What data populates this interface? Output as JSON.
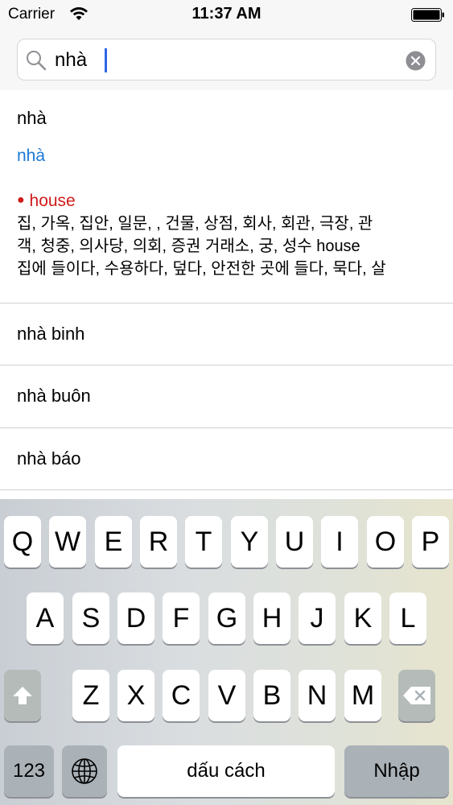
{
  "status_bar": {
    "carrier": "Carrier",
    "time": "11:37 AM"
  },
  "search": {
    "value": "nhà",
    "icons": [
      "search-icon",
      "clear-icon"
    ]
  },
  "results": {
    "expanded": {
      "title": "nhà",
      "sub_word": "nhà",
      "bullet": "●",
      "definition_word": "house",
      "meaning_lines": [
        "집, 가옥, 집안, 일문, , 건물, 상점, 회사, 회관, 극장, 관",
        "객, 청중, 의사당, 의회, 증권 거래소, 궁, 성수  house",
        "집에 들이다, 수용하다, 덮다, 안전한 곳에 들다, 묵다, 살"
      ]
    },
    "items": [
      "nhà binh",
      "nhà buôn",
      "nhà báo"
    ]
  },
  "keyboard": {
    "row1": [
      "Q",
      "W",
      "E",
      "R",
      "T",
      "Y",
      "U",
      "I",
      "O",
      "P"
    ],
    "row2": [
      "A",
      "S",
      "D",
      "F",
      "G",
      "H",
      "J",
      "K",
      "L"
    ],
    "row3": [
      "Z",
      "X",
      "C",
      "V",
      "B",
      "N",
      "M"
    ],
    "numbers_key": "123",
    "space_key": "dấu cách",
    "return_key": "Nhập",
    "icons": [
      "shift-icon",
      "delete-icon",
      "globe-icon"
    ]
  },
  "colors": {
    "link_blue": "#1a7ad8",
    "definition_red": "#d01b1b",
    "caret_blue": "#2f66e8"
  }
}
